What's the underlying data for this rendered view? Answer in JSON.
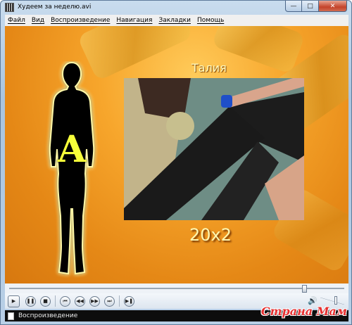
{
  "window": {
    "title": "Худеем за неделю.avi",
    "min_glyph": "—",
    "max_glyph": "□",
    "close_glyph": "✕"
  },
  "menu": {
    "items": [
      {
        "label": "Файл"
      },
      {
        "label": "Вид"
      },
      {
        "label": "Воспроизведение"
      },
      {
        "label": "Навигация"
      },
      {
        "label": "Закладки"
      },
      {
        "label": "Помощь"
      }
    ]
  },
  "video": {
    "section_title": "Талия",
    "figure_letter": "A",
    "repetitions": "20x2",
    "colors": {
      "background": "#f0a12a",
      "figure": "#000000",
      "glow": "#fffbb0",
      "letter": "#f7ff3a",
      "text": "#fff7b0"
    }
  },
  "playback": {
    "position_fraction": 0.88,
    "volume_fraction": 0.65,
    "buttons": {
      "play": "▶",
      "pause": "❚❚",
      "stop": "■",
      "prev": "⏮",
      "rewind": "◀◀",
      "forward": "▶▶",
      "next": "⏭",
      "frame_step": "▶❚",
      "volume": "🔊"
    }
  },
  "status": {
    "text": "Воспроизведение"
  },
  "watermark": {
    "text": "Страна Мам"
  }
}
